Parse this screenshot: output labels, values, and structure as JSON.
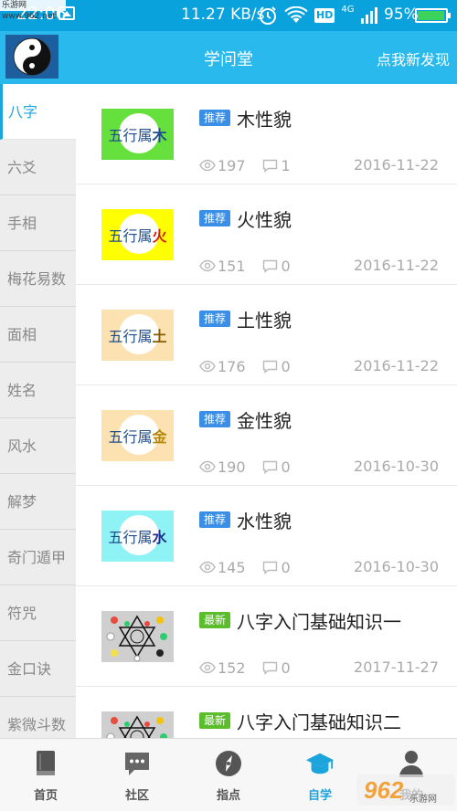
{
  "status_bar": {
    "time": "22:06",
    "network_speed": "11.27 KB/s",
    "hd": "HD",
    "signal_type": "4G",
    "battery_percent": "95%",
    "battery_level": 0.95,
    "icons": [
      "image-icon",
      "alarm-icon",
      "wifi-icon",
      "hd-icon",
      "signal-icon",
      "battery-icon"
    ]
  },
  "watermark_top": "乐游网 www.962.net",
  "header": {
    "title": "学问堂",
    "discover": "点我新发现",
    "background_color": "#29b9ec"
  },
  "sidebar": {
    "items": [
      {
        "label": "八字",
        "active": true
      },
      {
        "label": "六爻",
        "active": false
      },
      {
        "label": "手相",
        "active": false
      },
      {
        "label": "梅花易数",
        "active": false
      },
      {
        "label": "面相",
        "active": false
      },
      {
        "label": "姓名",
        "active": false
      },
      {
        "label": "风水",
        "active": false
      },
      {
        "label": "解梦",
        "active": false
      },
      {
        "label": "奇门遁甲",
        "active": false
      },
      {
        "label": "符咒",
        "active": false
      },
      {
        "label": "金口诀",
        "active": false
      },
      {
        "label": "紫微斗数",
        "active": false
      }
    ]
  },
  "articles": [
    {
      "thumb_prefix": "五行属",
      "thumb_element": "木",
      "thumb_bg": "#66e03c",
      "thumb_element_color": "#1e4e8c",
      "tag": "推荐",
      "tag_color": "#3a8ee6",
      "title": "木性貌",
      "views": "197",
      "comments": "1",
      "date": "2016-11-22"
    },
    {
      "thumb_prefix": "五行属",
      "thumb_element": "火",
      "thumb_bg": "#ffff00",
      "thumb_element_color": "#d81e06",
      "tag": "推荐",
      "tag_color": "#3a8ee6",
      "title": "火性貌",
      "views": "151",
      "comments": "0",
      "date": "2016-11-22"
    },
    {
      "thumb_prefix": "五行属",
      "thumb_element": "土",
      "thumb_bg": "#fbe2b0",
      "thumb_element_color": "#8a5a00",
      "tag": "推荐",
      "tag_color": "#3a8ee6",
      "title": "土性貌",
      "views": "176",
      "comments": "0",
      "date": "2016-11-22"
    },
    {
      "thumb_prefix": "五行属",
      "thumb_element": "金",
      "thumb_bg": "#fbe2b0",
      "thumb_element_color": "#b8860b",
      "tag": "推荐",
      "tag_color": "#3a8ee6",
      "title": "金性貌",
      "views": "190",
      "comments": "0",
      "date": "2016-10-30"
    },
    {
      "thumb_prefix": "五行属",
      "thumb_element": "水",
      "thumb_bg": "#8ff2f4",
      "thumb_element_color": "#1e2f8c",
      "tag": "推荐",
      "tag_color": "#3a8ee6",
      "title": "水性貌",
      "views": "145",
      "comments": "0",
      "date": "2016-10-30"
    },
    {
      "thumb_type": "diagram",
      "tag": "最新",
      "tag_color": "#5bbd2b",
      "title": "八字入门基础知识一",
      "views": "152",
      "comments": "0",
      "date": "2017-11-27"
    },
    {
      "thumb_type": "diagram",
      "tag": "最新",
      "tag_color": "#5bbd2b",
      "title": "八字入门基础知识二",
      "views": "",
      "comments": "",
      "date": ""
    }
  ],
  "bottom_nav": {
    "items": [
      {
        "label": "首页",
        "icon": "book-icon",
        "active": false
      },
      {
        "label": "社区",
        "icon": "chat-icon",
        "active": false
      },
      {
        "label": "指点",
        "icon": "compass-icon",
        "active": false
      },
      {
        "label": "自学",
        "icon": "graduation-cap-icon",
        "active": true
      },
      {
        "label": "我的",
        "icon": "user-icon",
        "active": false
      }
    ],
    "active_color": "#1ba5dc"
  }
}
